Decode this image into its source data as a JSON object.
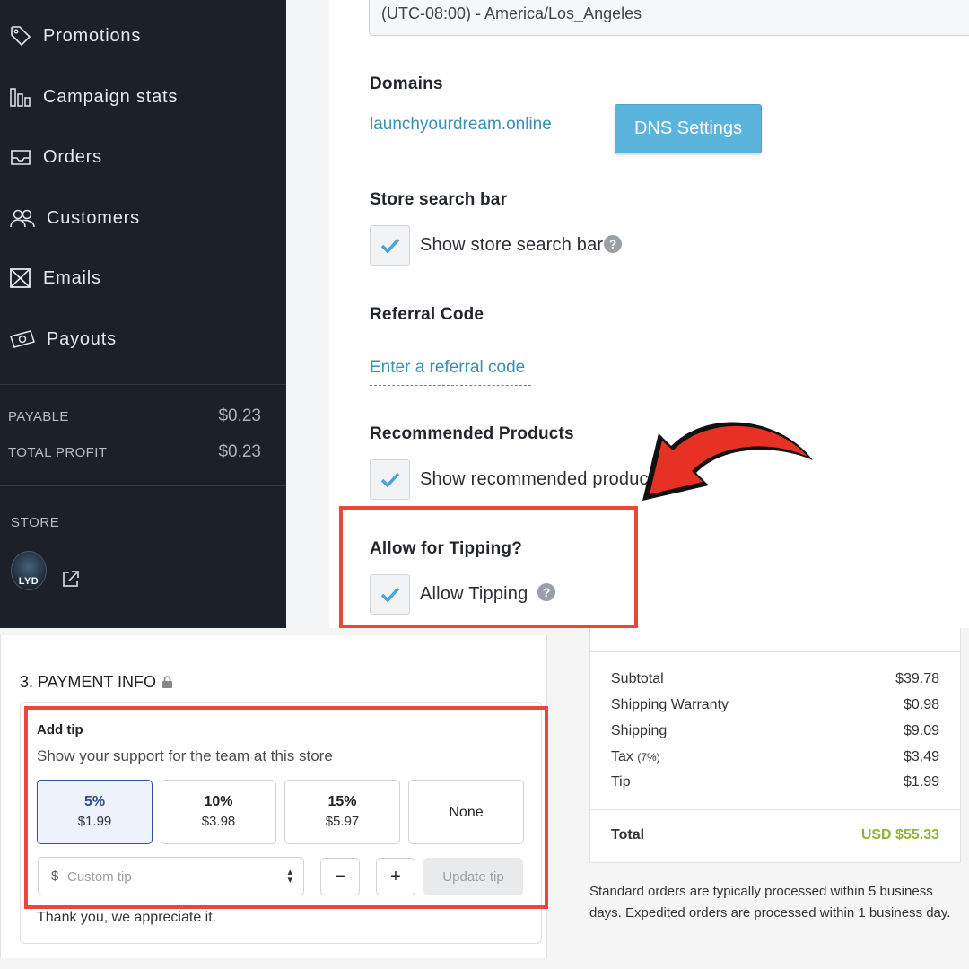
{
  "sidebar": {
    "nav": [
      {
        "label": "Promotions",
        "icon": "tag-icon"
      },
      {
        "label": "Campaign stats",
        "icon": "bar-chart-icon"
      },
      {
        "label": "Orders",
        "icon": "inbox-icon"
      },
      {
        "label": "Customers",
        "icon": "users-icon"
      },
      {
        "label": "Emails",
        "icon": "envelope-icon"
      },
      {
        "label": "Payouts",
        "icon": "money-icon"
      }
    ],
    "stats": {
      "payable_label": "PAYABLE",
      "payable_value": "$0.23",
      "profit_label": "TOTAL PROFIT",
      "profit_value": "$0.23"
    },
    "store_label": "STORE",
    "store_logo_text": "LYD"
  },
  "settings": {
    "timezone_value": "(UTC-08:00) - America/Los_Angeles",
    "domains_title": "Domains",
    "domain_link": "launchyourdream.online",
    "dns_button": "DNS Settings",
    "search_title": "Store search bar",
    "search_label": "Show store search bar",
    "referral_title": "Referral Code",
    "referral_placeholder": "Enter a referral code",
    "recommended_title": "Recommended Products",
    "recommended_label": "Show recommended products",
    "tipping_title": "Allow for Tipping?",
    "tipping_label": "Allow Tipping",
    "help_glyph": "?"
  },
  "payment": {
    "section_title": "3. PAYMENT INFO",
    "tip_title": "Add tip",
    "tip_subtitle": "Show your support for the team at this store",
    "options": [
      {
        "pct": "5%",
        "amount": "$1.99",
        "selected": true
      },
      {
        "pct": "10%",
        "amount": "$3.98",
        "selected": false
      },
      {
        "pct": "15%",
        "amount": "$5.97",
        "selected": false
      }
    ],
    "none_label": "None",
    "currency_symbol": "$",
    "custom_placeholder": "Custom tip",
    "minus_label": "−",
    "plus_label": "+",
    "update_label": "Update tip",
    "thanks": "Thank you, we appreciate it."
  },
  "summary": {
    "subtotal_label": "Subtotal",
    "subtotal_value": "$39.78",
    "warranty_label": "Shipping Warranty",
    "warranty_value": "$0.98",
    "shipping_label": "Shipping",
    "shipping_value": "$9.09",
    "tax_label": "Tax",
    "tax_rate": "(7%)",
    "tax_value": "$3.49",
    "tip_label": "Tip",
    "tip_value": "$1.99",
    "total_label": "Total",
    "total_value": "USD $55.33",
    "note": "Standard orders are typically processed within 5 business days. Expedited orders are processed within 1 business day."
  },
  "colors": {
    "sidebar_bg": "#1c2129",
    "link": "#3a8fb5",
    "dns_button": "#5bb4dc",
    "highlight": "#e8473a",
    "selected_tip": "#33539a",
    "total_green": "#8db43a"
  }
}
